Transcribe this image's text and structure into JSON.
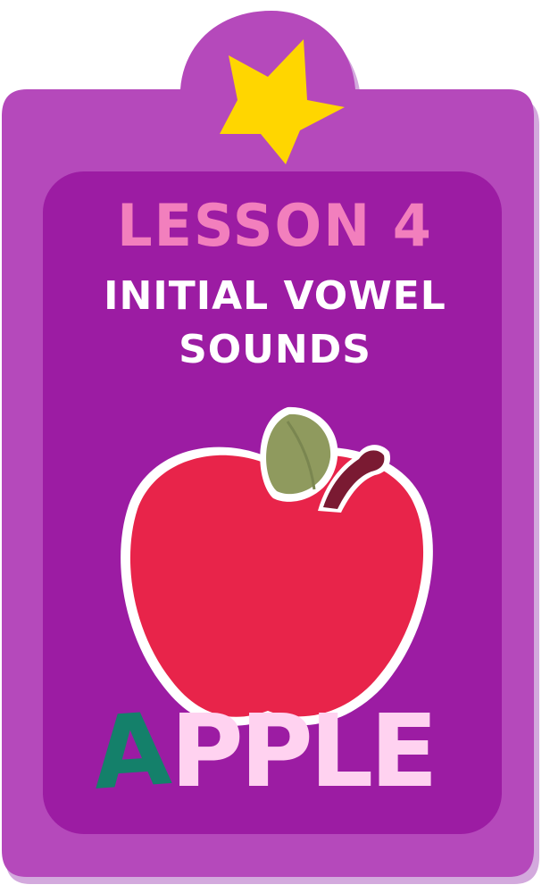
{
  "card": {
    "lesson_label": "LESSON 4",
    "topic_line1": "INITIAL VOWEL",
    "topic_line2": "SOUNDS",
    "word_initial": "A",
    "word_rest": "PPLE"
  },
  "colors": {
    "card_outer": "#b549bb",
    "card_inner": "#9c1ca3",
    "card_shadow": "#d3a9dd",
    "star": "#ffd600",
    "lesson_text": "#f27fbd",
    "topic_text": "#ffffff",
    "apple_body": "#e8244a",
    "apple_leaf": "#8f9a5e",
    "apple_stem": "#7a1a32",
    "word_initial": "#14806a",
    "word_rest": "#ffd2f0"
  },
  "icons": [
    "star-icon",
    "apple-illustration"
  ]
}
